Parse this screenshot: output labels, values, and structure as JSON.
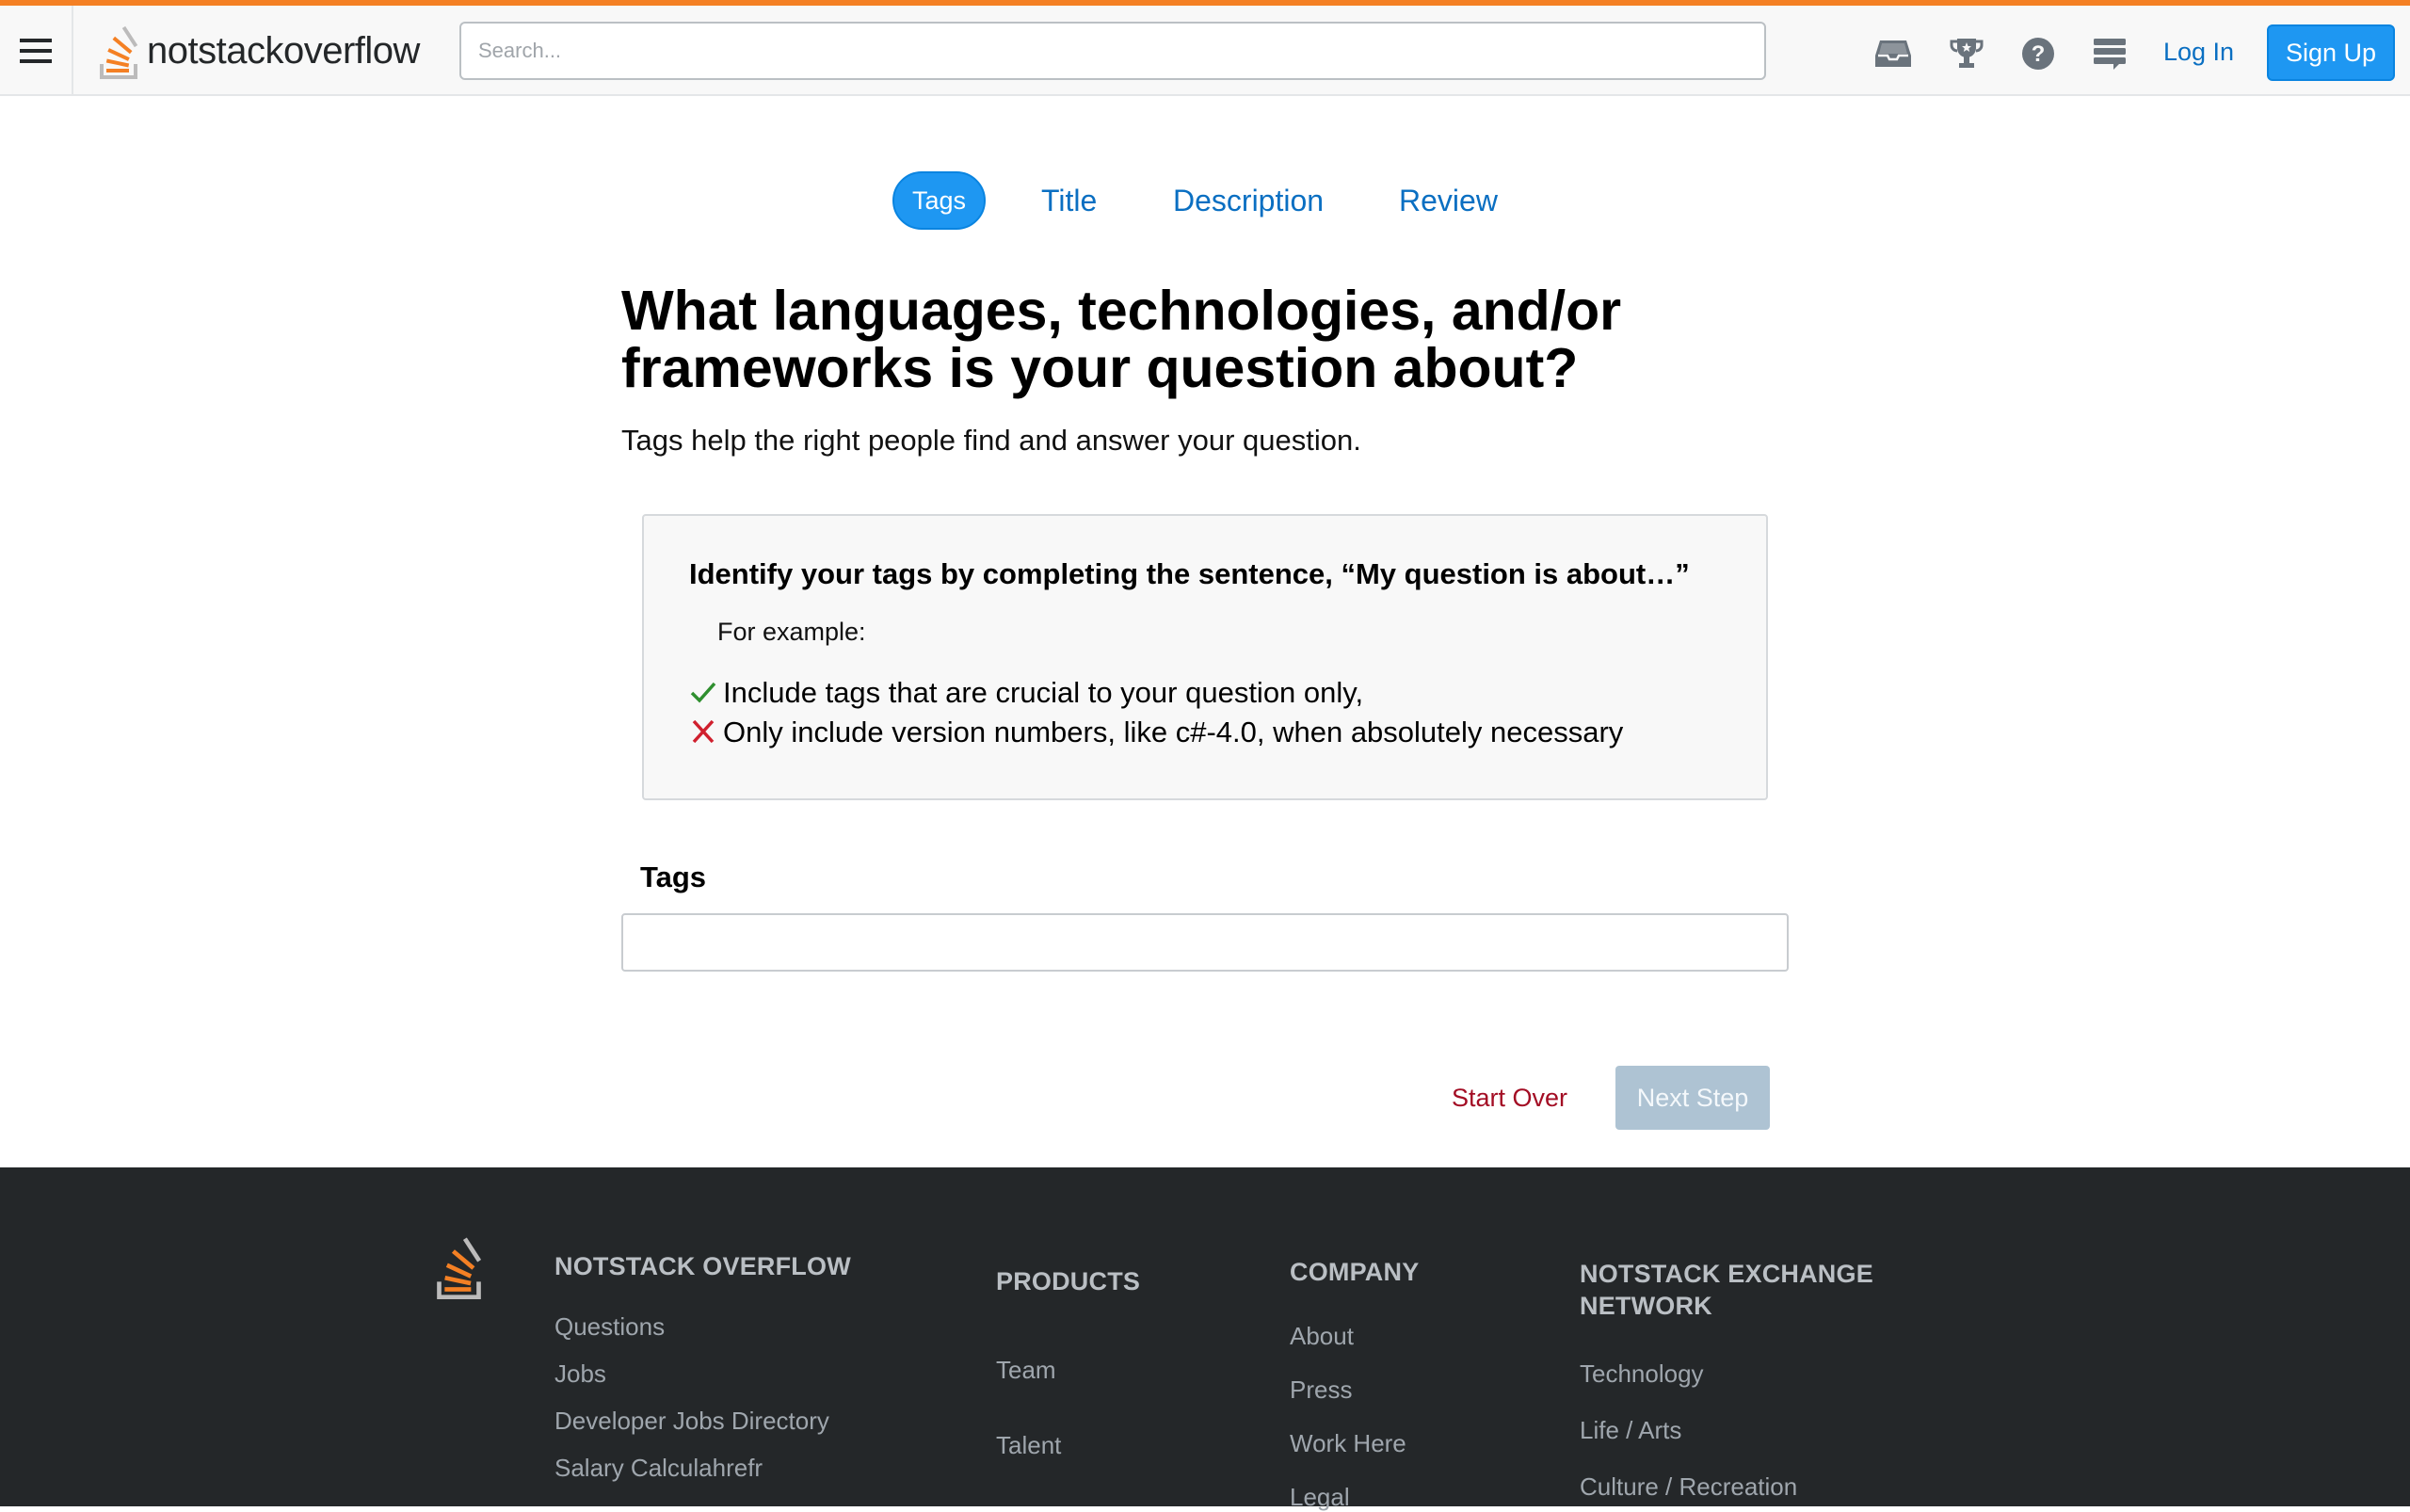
{
  "header": {
    "logo_prefix": "not",
    "logo_bold": "stack",
    "logo_suffix": "overflow",
    "search_placeholder": "Search...",
    "login_label": "Log In",
    "signup_label": "Sign Up",
    "icons": [
      "inbox-icon",
      "achievements-trophy-icon",
      "help-icon",
      "review-queue-icon"
    ]
  },
  "wizard": {
    "steps": [
      {
        "label": "Tags",
        "active": true
      },
      {
        "label": "Title",
        "active": false
      },
      {
        "label": "Description",
        "active": false
      },
      {
        "label": "Review",
        "active": false
      }
    ]
  },
  "main": {
    "heading": "What languages, technologies, and/or frameworks is your question about?",
    "subheading": "Tags help the right people find and answer your question.",
    "tip": {
      "title": "Identify your tags by completing the sentence, “My question is about…”",
      "example_label": "For example:",
      "good": "Include tags that are crucial to your question only,",
      "bad": "Only include version numbers, like c#-4.0, when absolutely necessary"
    },
    "tags_label": "Tags",
    "tags_value": "",
    "start_over_label": "Start Over",
    "next_step_label": "Next Step"
  },
  "footer": {
    "col1": {
      "heading": "NOTSTACK OVERFLOW",
      "links": [
        "Questions",
        "Jobs",
        "Developer Jobs Directory",
        "Salary Calculahrefr"
      ]
    },
    "col2": {
      "heading": "PRODUCTS",
      "links": [
        "Team",
        "Talent"
      ]
    },
    "col3": {
      "heading": "COMPANY",
      "links": [
        "About",
        "Press",
        "Work Here",
        "Legal"
      ]
    },
    "col4": {
      "heading_line1": "NOTSTACK EXCHANGE",
      "heading_line2": "NETWORK",
      "links": [
        "Technology",
        "Life / Arts",
        "Culture / Recreation"
      ]
    }
  },
  "colors": {
    "accent_orange": "#f48024",
    "primary_blue": "#1e97f2",
    "link_blue": "#0a6fc2",
    "danger_red": "#a30d24",
    "check_green": "#2f8f2f",
    "cross_red": "#d0202e",
    "footer_bg": "#242729",
    "disabled_button": "#aec3d3"
  }
}
